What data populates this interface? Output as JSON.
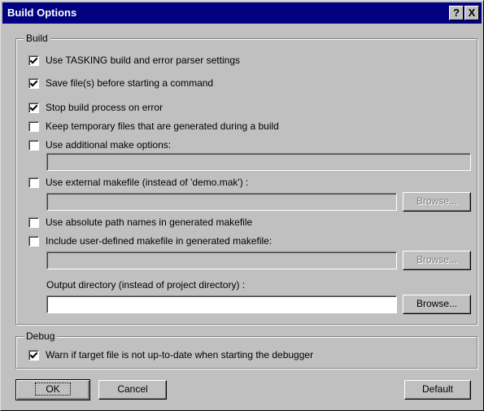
{
  "window": {
    "title": "Build Options",
    "help_button": "?",
    "close_button": "X"
  },
  "build_group": {
    "legend": "Build"
  },
  "options": {
    "use_tasking": {
      "label": "Use TASKING build and error parser settings",
      "checked": true
    },
    "save_files": {
      "label": "Save file(s) before starting a command",
      "checked": true
    },
    "stop_on_error": {
      "label": "Stop build process on error",
      "checked": true
    },
    "keep_temp": {
      "label": "Keep temporary files that are generated during a build",
      "checked": false
    },
    "additional_make": {
      "label": "Use additional make options:",
      "checked": false,
      "value": ""
    },
    "external_makefile": {
      "label": "Use external makefile (instead of 'demo.mak') :",
      "checked": false,
      "value": "",
      "browse_label": "Browse..."
    },
    "absolute_paths": {
      "label": "Use absolute path names in generated makefile",
      "checked": false
    },
    "include_user_makefile": {
      "label": "Include user-defined makefile in generated makefile:",
      "checked": false,
      "value": "",
      "browse_label": "Browse..."
    },
    "output_directory": {
      "label": "Output directory (instead of project directory) :",
      "value": "",
      "browse_label": "Browse..."
    }
  },
  "debug_group": {
    "legend": "Debug",
    "warn_target": {
      "label": "Warn if target file is not up-to-date when starting the debugger",
      "checked": true
    }
  },
  "buttons": {
    "ok": "OK",
    "cancel": "Cancel",
    "default": "Default"
  }
}
